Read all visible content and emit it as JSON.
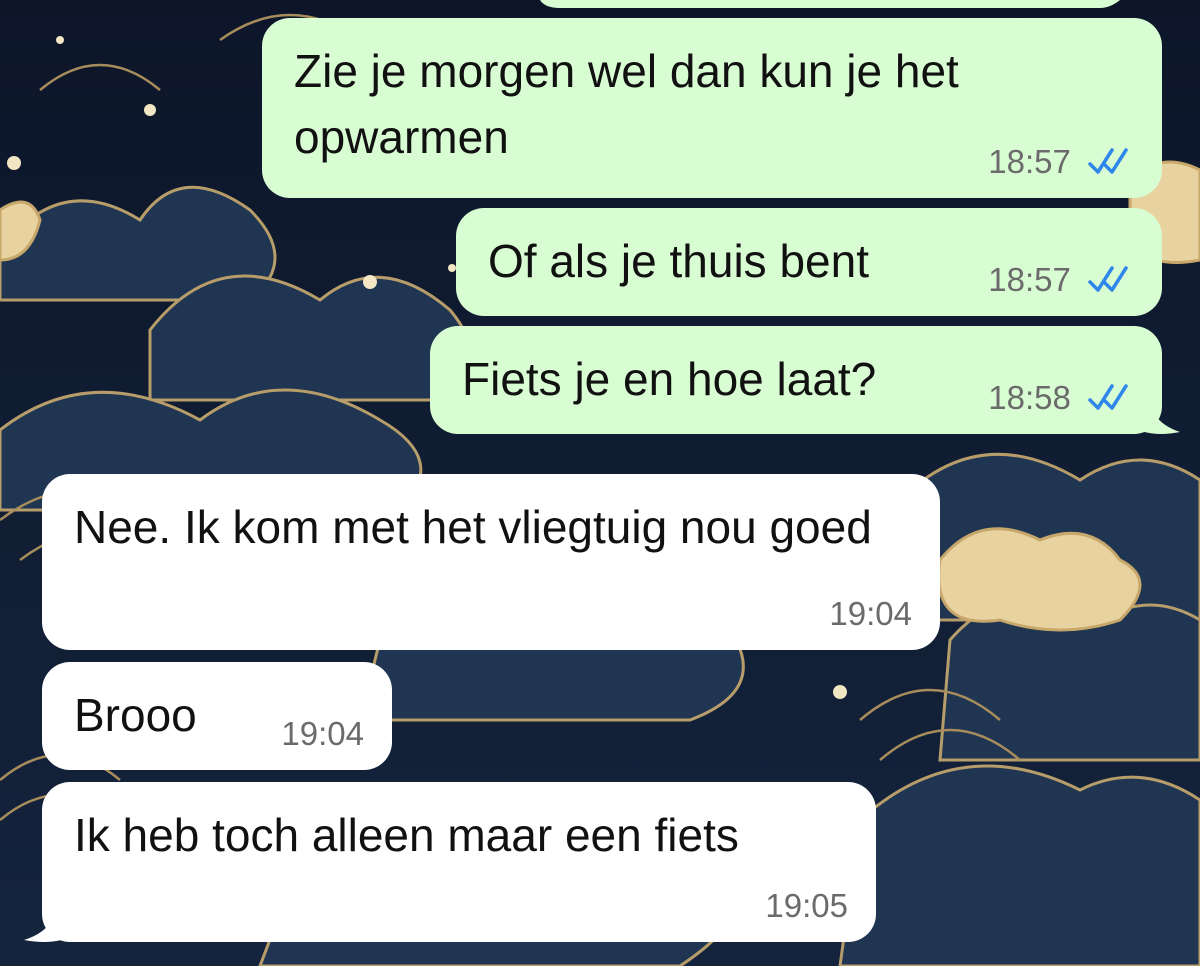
{
  "chat": {
    "messages": [
      {
        "id": "m1",
        "direction": "outgoing",
        "text": "Zie je morgen wel dan kun je het opwarmen",
        "time": "18:57",
        "status": "read"
      },
      {
        "id": "m2",
        "direction": "outgoing",
        "text": "Of als je thuis bent",
        "time": "18:57",
        "status": "read"
      },
      {
        "id": "m3",
        "direction": "outgoing",
        "text": "Fiets je en hoe laat?",
        "time": "18:58",
        "status": "read"
      },
      {
        "id": "m4",
        "direction": "incoming",
        "text": "Nee. Ik kom met het vliegtuig nou goed",
        "time": "19:04"
      },
      {
        "id": "m5",
        "direction": "incoming",
        "text": "Brooo",
        "time": "19:04"
      },
      {
        "id": "m6",
        "direction": "incoming",
        "text": "Ik heb toch alleen maar een fiets",
        "time": "19:05"
      }
    ]
  },
  "colors": {
    "outgoing_bubble": "#d9fdd3",
    "incoming_bubble": "#ffffff",
    "read_ticks": "#2f86eb",
    "wallpaper": "#0f1a2e"
  },
  "icons": {
    "read_receipt": "double-check-icon"
  }
}
